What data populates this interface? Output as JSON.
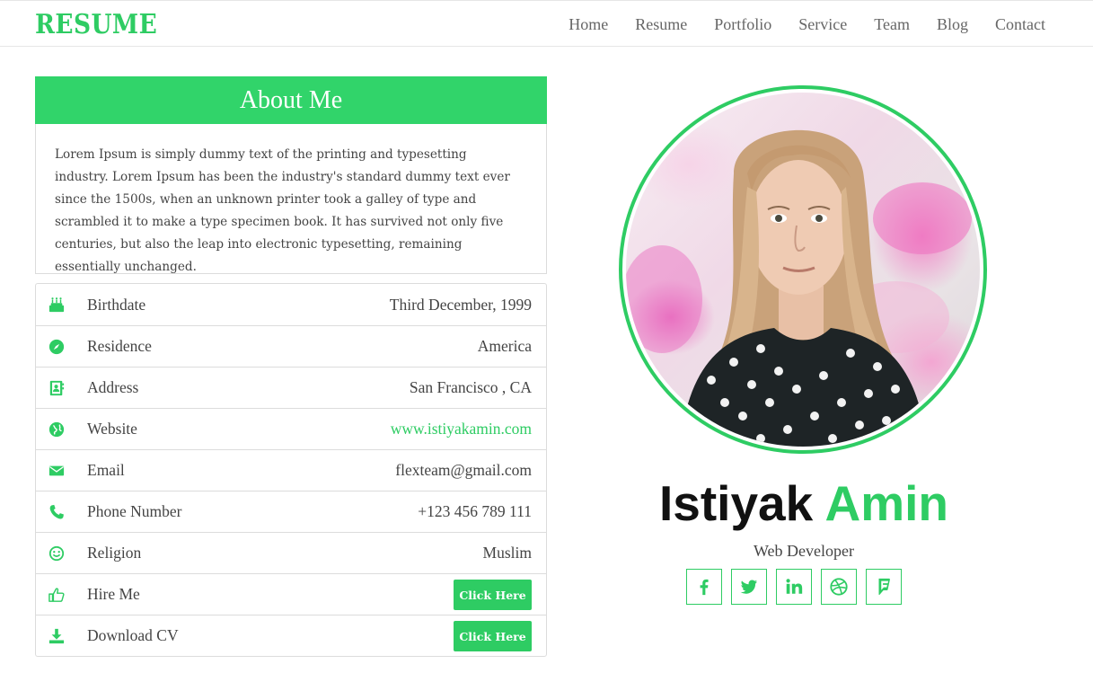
{
  "header": {
    "logo": "RESUME",
    "nav": [
      "Home",
      "Resume",
      "Portfolio",
      "Service",
      "Team",
      "Blog",
      "Contact"
    ]
  },
  "about": {
    "title": "About Me",
    "text": "Lorem Ipsum is simply dummy text of the printing and typesetting industry. Lorem Ipsum has been the industry's standard dummy text ever since the 1500s, when an unknown printer took a galley of type and scrambled it to make a type specimen book. It has survived not only five centuries, but also the leap into electronic typesetting, remaining essentially unchanged."
  },
  "info": [
    {
      "label": "Birthdate",
      "value": "Third December, 1999",
      "icon": "cake-icon"
    },
    {
      "label": "Residence",
      "value": "America",
      "icon": "compass-icon"
    },
    {
      "label": "Address",
      "value": "San Francisco , CA",
      "icon": "address-book-icon"
    },
    {
      "label": "Website",
      "value": "www.istiyakamin.com",
      "icon": "globe-icon"
    },
    {
      "label": "Email",
      "value": "flexteam@gmail.com",
      "icon": "envelope-icon"
    },
    {
      "label": "Phone Number",
      "value": "+123 456 789 111",
      "icon": "phone-icon"
    },
    {
      "label": "Religion",
      "value": "Muslim",
      "icon": "smile-icon"
    },
    {
      "label": "Hire Me",
      "button": "Click Here",
      "icon": "thumbs-up-icon"
    },
    {
      "label": "Download CV",
      "button": "Click Here",
      "icon": "download-icon"
    }
  ],
  "profile": {
    "first_name": "Istiyak",
    "last_name": "Amin",
    "role": "Web Developer",
    "socials": [
      "facebook-icon",
      "twitter-icon",
      "linkedin-icon",
      "dribbble-icon",
      "foursquare-icon"
    ]
  },
  "colors": {
    "accent": "#2ecc63",
    "text": "#444444"
  }
}
